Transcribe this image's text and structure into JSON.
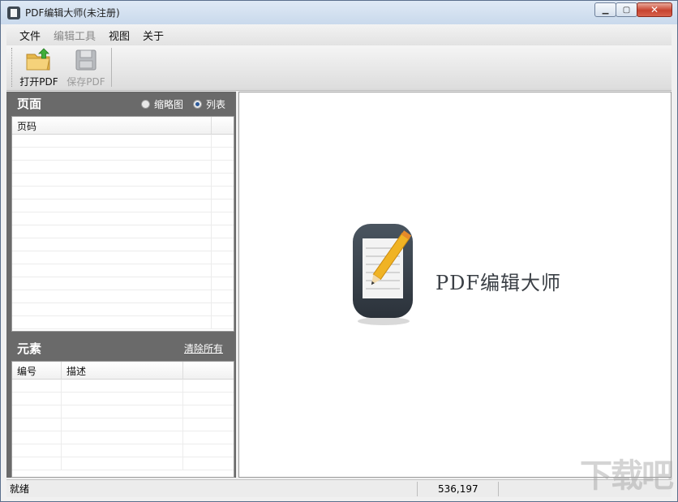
{
  "window": {
    "title": "PDF编辑大师(未注册)"
  },
  "menubar": {
    "items": [
      "文件",
      "编辑工具",
      "视图",
      "关于"
    ]
  },
  "toolbar": {
    "open_label": "打开PDF",
    "save_label": "保存PDF"
  },
  "pages_panel": {
    "title": "页面",
    "view_options": [
      {
        "label": "缩略图",
        "selected": false
      },
      {
        "label": "列表",
        "selected": true
      }
    ],
    "columns": [
      "页码"
    ],
    "rows": []
  },
  "elements_panel": {
    "title": "元素",
    "clear_label": "清除所有",
    "columns": [
      "编号",
      "描述"
    ],
    "rows": []
  },
  "canvas": {
    "logo_text": "PDF编辑大师"
  },
  "statusbar": {
    "status": "就绪",
    "coords": "536,197"
  },
  "watermark": {
    "text": "下载吧"
  }
}
